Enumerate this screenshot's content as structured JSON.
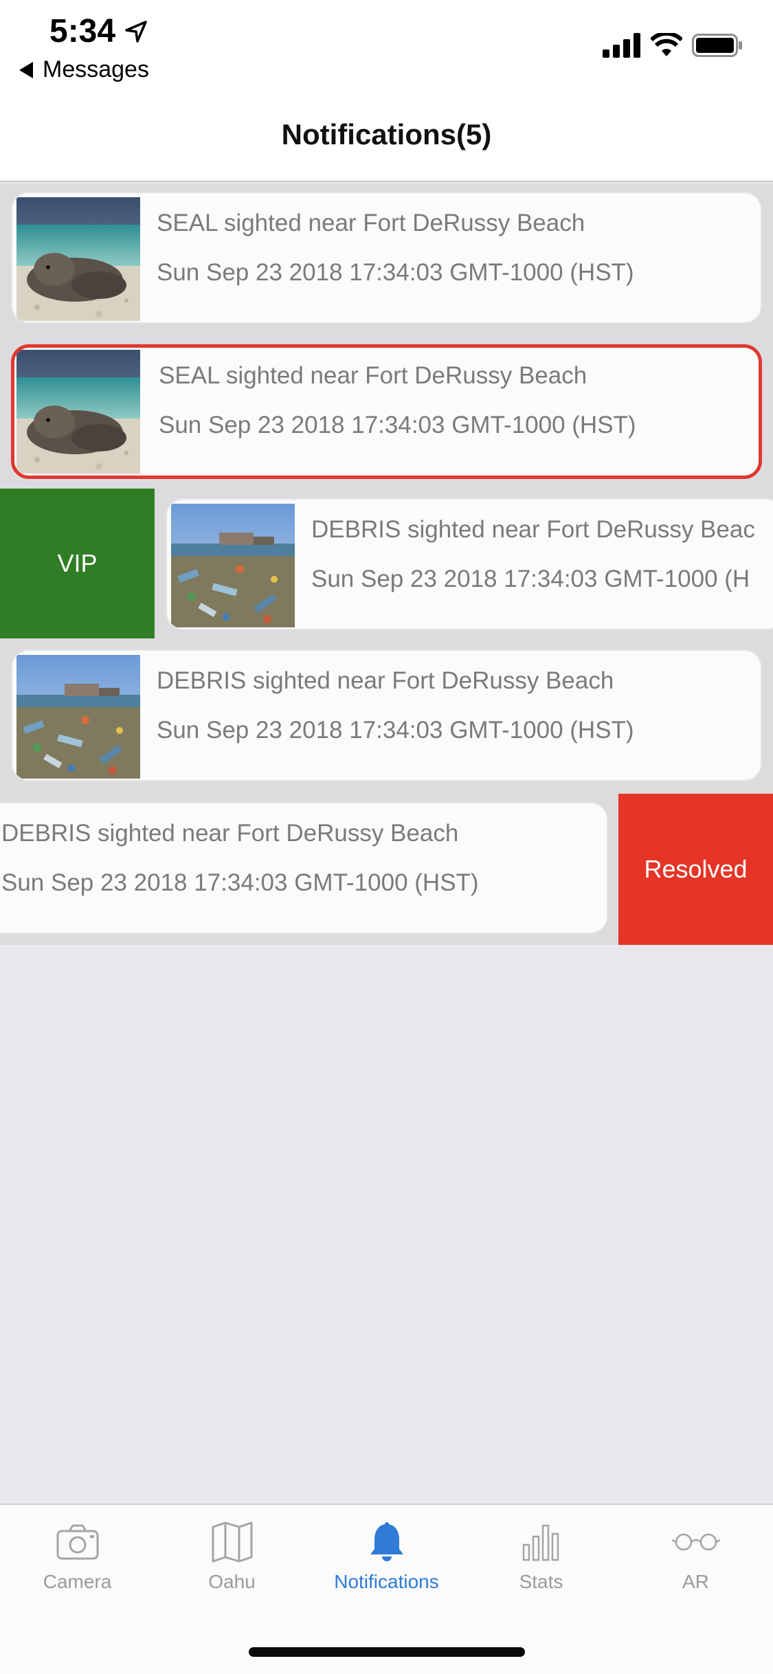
{
  "status_bar": {
    "time": "5:34",
    "back_app": "Messages"
  },
  "nav": {
    "title": "Notifications(5)"
  },
  "notifications": [
    {
      "title": "SEAL sighted near Fort DeRussy Beach",
      "date": "Sun Sep 23 2018 17:34:03 GMT-1000 (HST)",
      "image": "seal-photo"
    },
    {
      "title": "SEAL sighted near Fort DeRussy Beach",
      "date": "Sun Sep 23 2018 17:34:03 GMT-1000 (HST)",
      "image": "seal-photo",
      "selected": true
    },
    {
      "title": "DEBRIS sighted near Fort DeRussy Beac",
      "date": "Sun Sep 23 2018 17:34:03 GMT-1000 (H",
      "image": "debris-photo",
      "swipe_action": "VIP"
    },
    {
      "title": "DEBRIS sighted near Fort DeRussy Beach",
      "date": "Sun Sep 23 2018 17:34:03 GMT-1000 (HST)",
      "image": "debris-photo"
    },
    {
      "title": "DEBRIS sighted near Fort DeRussy Beach",
      "date": "Sun Sep 23 2018 17:34:03 GMT-1000 (HST)",
      "swipe_action": "Resolved"
    }
  ],
  "actions": {
    "vip_label": "VIP",
    "resolved_label": "Resolved"
  },
  "tabs": [
    {
      "label": "Camera",
      "icon": "camera-icon"
    },
    {
      "label": "Oahu",
      "icon": "map-icon"
    },
    {
      "label": "Notifications",
      "icon": "bell-icon",
      "active": true
    },
    {
      "label": "Stats",
      "icon": "bar-chart-icon"
    },
    {
      "label": "AR",
      "icon": "glasses-icon"
    }
  ],
  "colors": {
    "accent": "#2f7bd6",
    "vip": "#2f7d24",
    "resolved": "#e53526",
    "selected_border": "#e0382f"
  }
}
